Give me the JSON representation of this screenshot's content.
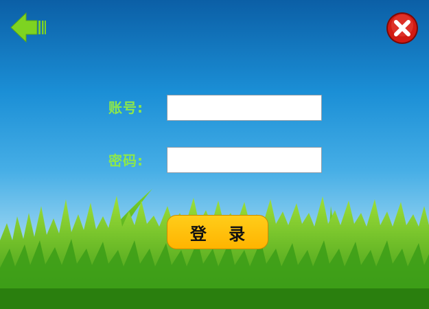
{
  "form": {
    "account_label": "账号:",
    "account_value": "",
    "password_label": "密码:",
    "password_value": ""
  },
  "actions": {
    "login_label": "登 录"
  },
  "icons": {
    "back": "back-arrow-icon",
    "close": "close-icon"
  },
  "colors": {
    "label_green": "#8de84a",
    "button_yellow": "#ffb400",
    "close_red": "#d11a12",
    "sky_top": "#0b5fa6"
  }
}
